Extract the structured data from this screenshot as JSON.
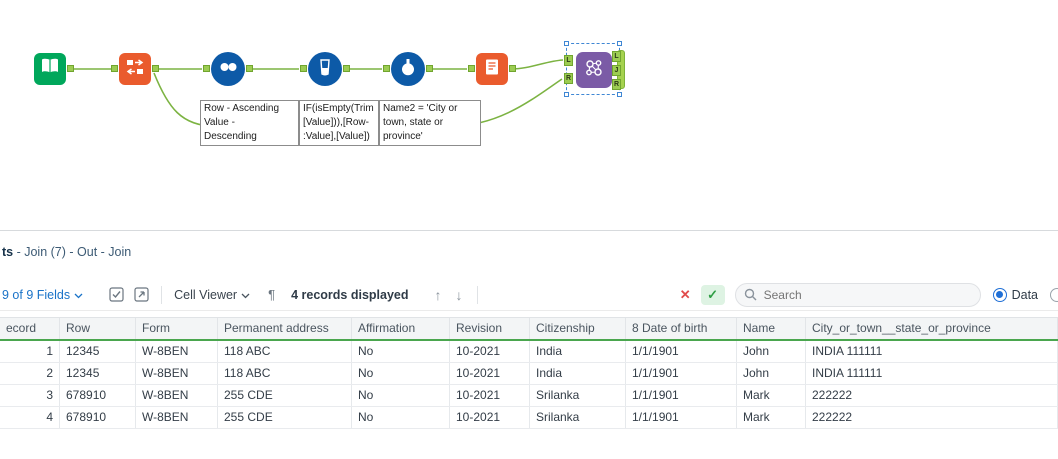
{
  "colors": {
    "wire_green": "#7cb342",
    "anchor_green": "#9ccc52",
    "input_tool_green": "#00a75b",
    "orange_tool": "#ea5b2d",
    "blue_tool": "#0d5aa7",
    "join_purple": "#7b5ba6",
    "header_underline_green": "#4aa64e",
    "link_blue": "#1a73c8",
    "radio_blue": "#1f6fd6",
    "cancel_red": "#e14b4b",
    "confirm_green": "#2f9e44"
  },
  "canvas": {
    "tools": [
      "input-data",
      "record-id",
      "sort",
      "multi-row-formula",
      "formula",
      "select",
      "join"
    ],
    "annotations": [
      {
        "lines": [
          "Row - Ascending",
          "Value -",
          "Descending"
        ]
      },
      {
        "lines": [
          "IF(isEmpty(Trim",
          "[Value])),[Row-",
          ":Value],[Value])"
        ]
      },
      {
        "lines": [
          "Name2 = 'City or",
          "town, state or",
          "province'"
        ]
      }
    ],
    "join": {
      "left_anchors": [
        "L",
        "R"
      ],
      "right_anchors": [
        "L",
        "J",
        "R"
      ]
    }
  },
  "results": {
    "breadcrumb": {
      "bold": "ts",
      "rest": " - Join (7) - Out - Join"
    },
    "toolbar": {
      "fields_label": "9 of 9 Fields",
      "cell_viewer_label": "Cell Viewer",
      "records_label": "4 records displayed",
      "search_placeholder": "Search",
      "data_radio_label": "Data",
      "icons": {
        "cancel": "✕",
        "confirm": "✓",
        "pilcrow": "¶",
        "up": "↑",
        "down": "↓"
      }
    },
    "table": {
      "columns": [
        "ecord",
        "Row",
        "Form",
        "Permanent address",
        "Affirmation",
        "Revision",
        "Citizenship",
        "8 Date of birth",
        "Name",
        "City_or_town__state_or_province"
      ],
      "rows": [
        [
          "1",
          "12345",
          "W-8BEN",
          "118 ABC",
          "No",
          "10-2021",
          "India",
          "1/1/1901",
          "John",
          "INDIA 111111"
        ],
        [
          "2",
          "12345",
          "W-8BEN",
          "118 ABC",
          "No",
          "10-2021",
          "India",
          "1/1/1901",
          "John",
          "INDIA 111111"
        ],
        [
          "3",
          "678910",
          "W-8BEN",
          "255 CDE",
          "No",
          "10-2021",
          "Srilanka",
          "1/1/1901",
          "Mark",
          "222222"
        ],
        [
          "4",
          "678910",
          "W-8BEN",
          "255 CDE",
          "No",
          "10-2021",
          "Srilanka",
          "1/1/1901",
          "Mark",
          "222222"
        ]
      ]
    }
  }
}
